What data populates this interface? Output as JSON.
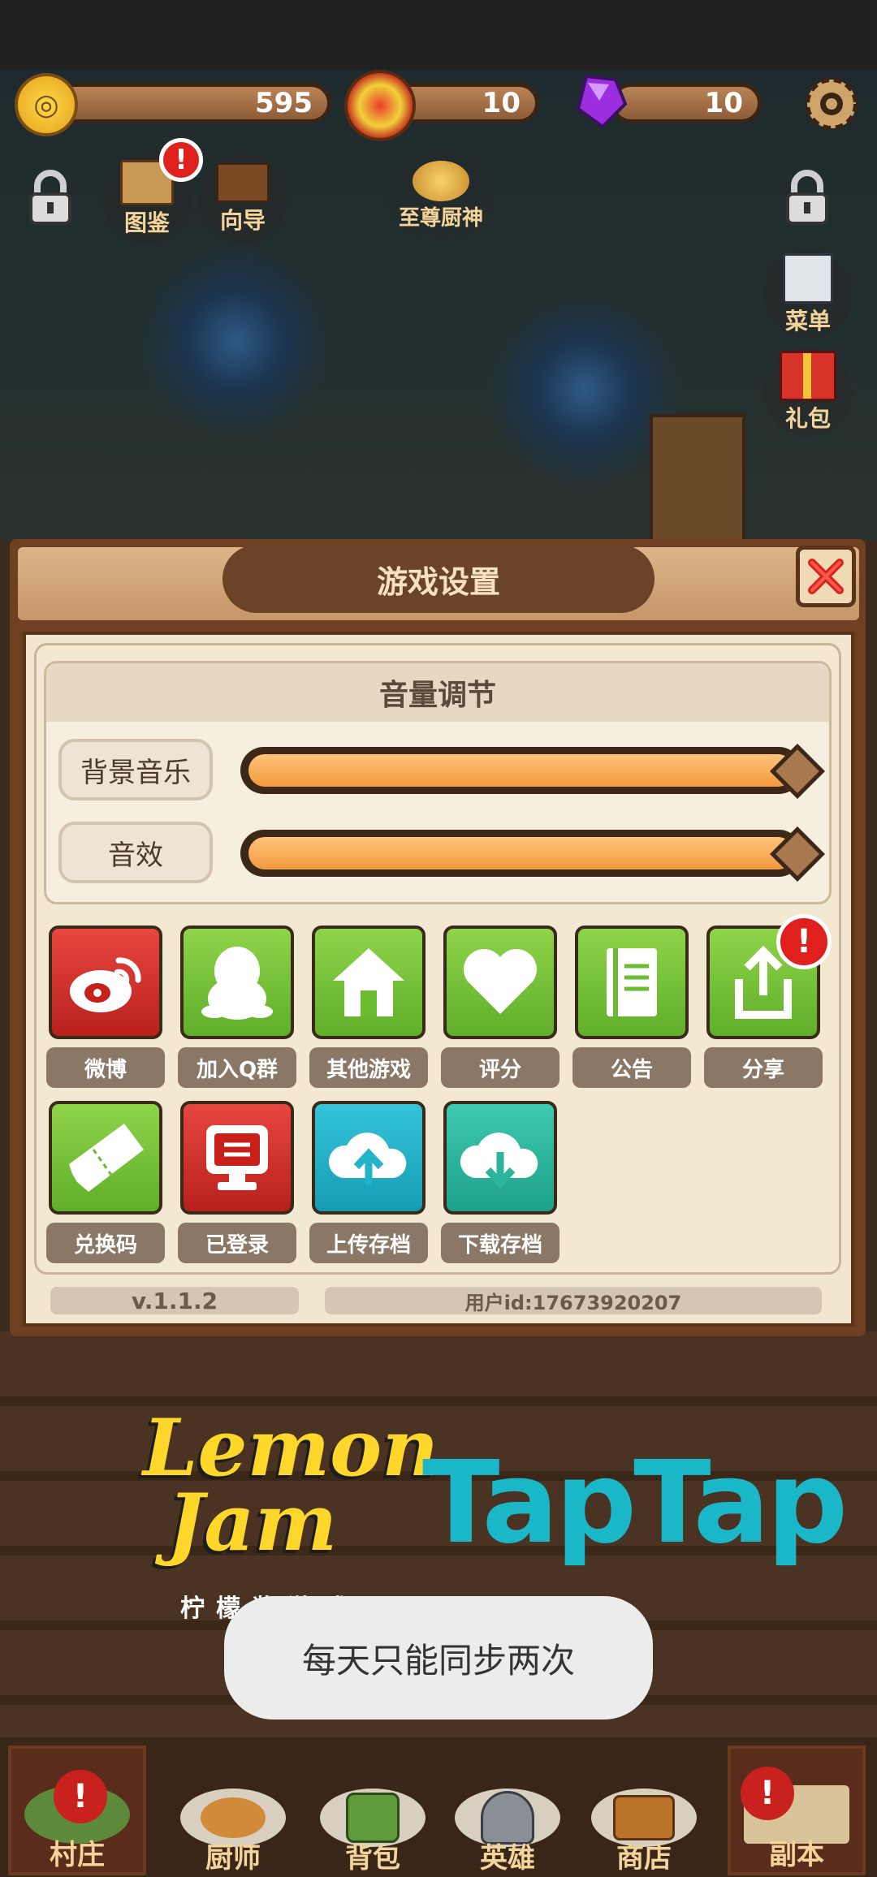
{
  "resources": {
    "coins": "595",
    "medals": "10",
    "gems": "10"
  },
  "top_left_buttons": [
    {
      "label": "图鉴",
      "icon": "book-icon"
    },
    {
      "label": "向导",
      "icon": "signpost-icon"
    },
    {
      "label": "至尊厨神",
      "icon": "trophy-icon"
    }
  ],
  "right_buttons": [
    {
      "label": "菜单",
      "icon": "menu-scroll-icon"
    },
    {
      "label": "礼包",
      "icon": "gift-icon"
    }
  ],
  "dialog": {
    "title": "游戏设置",
    "volume": {
      "header": "音量调节",
      "bgm_label": "背景音乐",
      "bgm_level": 1.0,
      "sfx_label": "音效",
      "sfx_level": 1.0
    },
    "buttons": [
      {
        "label": "微博",
        "icon": "weibo-icon",
        "color": "#d22a25"
      },
      {
        "label": "加入Q群",
        "icon": "qq-penguin-icon",
        "color": "#6cbc32"
      },
      {
        "label": "其他游戏",
        "icon": "home-icon",
        "color": "#6cbc32"
      },
      {
        "label": "评分",
        "icon": "heart-icon",
        "color": "#6cbc32"
      },
      {
        "label": "公告",
        "icon": "notebook-icon",
        "color": "#6cbc32"
      },
      {
        "label": "分享",
        "icon": "share-icon",
        "color": "#6cbc32"
      },
      {
        "label": "兑换码",
        "icon": "ticket-icon",
        "color": "#6cbc32"
      },
      {
        "label": "已登录",
        "icon": "monitor-icon",
        "color": "#d22a25"
      },
      {
        "label": "上传存档",
        "icon": "cloud-upload-icon",
        "color": "#25b3c9"
      },
      {
        "label": "下载存档",
        "icon": "cloud-download-icon",
        "color": "#2bb59c"
      }
    ],
    "version": "v.1.1.2",
    "user_id": "用户id:17673920207"
  },
  "brand": {
    "lemon_line1": "Lemon",
    "lemon_line2": "Jam",
    "lemon_sub": "柠檬酱游戏",
    "taptap": "TapTap"
  },
  "toast": "每天只能同步两次",
  "bottom_nav": [
    {
      "label": "村庄",
      "icon": "village-icon"
    },
    {
      "label": "厨师",
      "icon": "roast-chicken-icon"
    },
    {
      "label": "背包",
      "icon": "backpack-icon"
    },
    {
      "label": "英雄",
      "icon": "helmet-icon"
    },
    {
      "label": "商店",
      "icon": "treasure-chest-icon"
    },
    {
      "label": "副本",
      "icon": "map-icon"
    }
  ],
  "alert_glyph": "!"
}
